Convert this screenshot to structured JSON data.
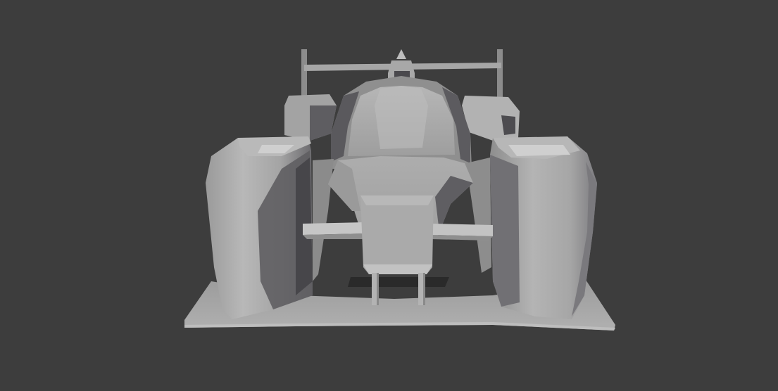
{
  "viewport": {
    "background": "#3d3d3d",
    "subject": "car-model"
  },
  "palette": {
    "base": "#a9a9a9",
    "light": "#bdbdbd",
    "highlight": "#cfcfcf",
    "mid": "#8f8f8f",
    "shadow": "#5f5e62",
    "deep_shadow": "#47464a",
    "ground_gap": "#2a2a2a"
  }
}
